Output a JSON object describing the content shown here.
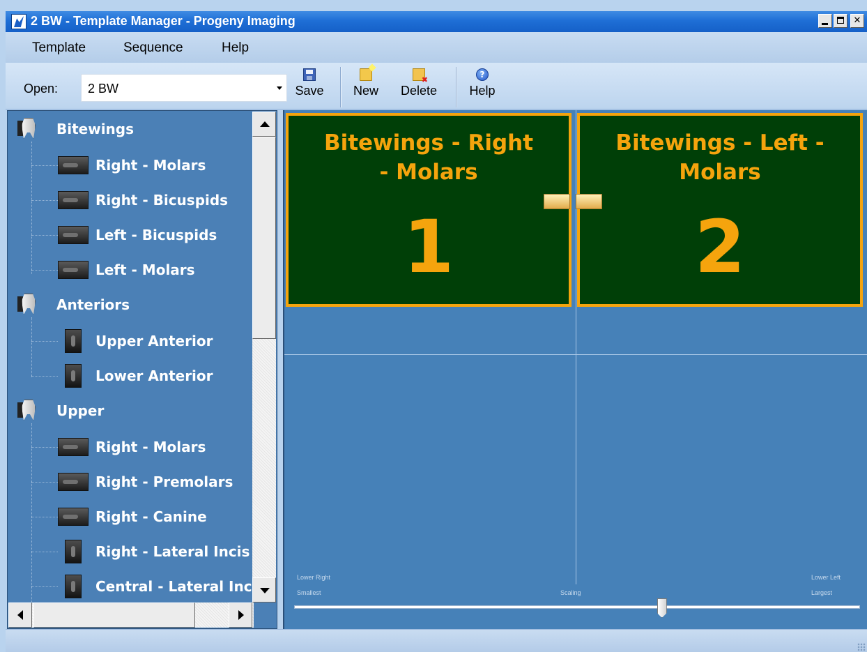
{
  "window": {
    "title": "2 BW - Template Manager - Progeny Imaging"
  },
  "menu": {
    "items": [
      "Template",
      "Sequence",
      "Help"
    ]
  },
  "toolbar": {
    "open_label": "Open:",
    "open_value": "2 BW",
    "buttons": [
      "Save",
      "New",
      "Delete",
      "Help"
    ]
  },
  "tree": {
    "categories": [
      {
        "label": "Bitewings",
        "children": [
          "Right - Molars",
          "Right - Bicuspids",
          "Left - Bicuspids",
          "Left - Molars"
        ]
      },
      {
        "label": "Anteriors",
        "children": [
          "Upper Anterior",
          "Lower Anterior"
        ]
      },
      {
        "label": "Upper",
        "children": [
          "Right - Molars",
          "Right - Premolars",
          "Right - Canine",
          "Right - Lateral Incis",
          "Central - Lateral Inc"
        ]
      }
    ]
  },
  "slots": [
    {
      "title_line1": "Bitewings - Right",
      "title_line2": "- Molars",
      "number": "1"
    },
    {
      "title_line1": "Bitewings - Left -",
      "title_line2": "Molars",
      "number": "2"
    }
  ],
  "scaling": {
    "left_top": "Lower Right",
    "left_bottom": "Smallest",
    "center": "Scaling",
    "right_top": "Lower Left",
    "right_bottom": "Largest",
    "value": 0.65
  },
  "colors": {
    "slot_bg": "#003f07",
    "slot_accent": "#f5a40d",
    "canvas_bg": "#4681b8",
    "tree_bg": "#4b80b6"
  }
}
